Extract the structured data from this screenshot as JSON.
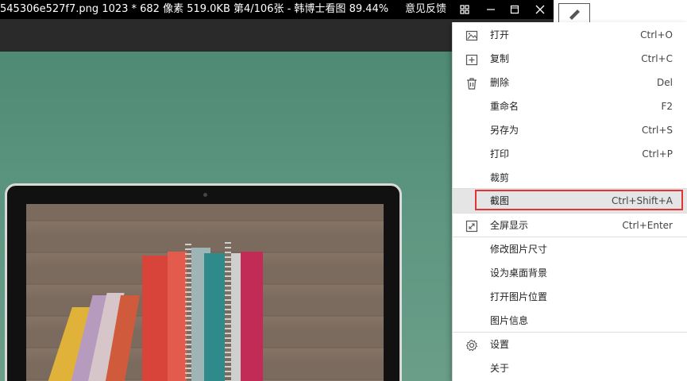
{
  "titlebar": {
    "title": "545306e527f7.png  1023 * 682 像素  519.0KB  第4/106张  - 韩博士看图 89.44%",
    "feedback": "意见反馈",
    "icons": [
      "grid-icon",
      "minimize-icon",
      "maximize-icon",
      "close-icon"
    ]
  },
  "menu": {
    "items": [
      {
        "label": "打开",
        "shortcut": "Ctrl+O",
        "icon": "image-icon"
      },
      {
        "label": "复制",
        "shortcut": "Ctrl+C",
        "icon": "copy-icon"
      },
      {
        "label": "删除",
        "shortcut": "Del",
        "icon": "trash-icon"
      },
      {
        "label": "重命名",
        "shortcut": "F2"
      },
      {
        "label": "另存为",
        "shortcut": "Ctrl+S"
      },
      {
        "label": "打印",
        "shortcut": "Ctrl+P"
      },
      {
        "label": "裁剪",
        "shortcut": ""
      },
      {
        "label": "截图",
        "shortcut": "Ctrl+Shift+A",
        "highlighted": true
      },
      {
        "label": "全屏显示",
        "shortcut": "Ctrl+Enter",
        "icon": "fullscreen-icon"
      },
      {
        "label": "修改图片尺寸",
        "shortcut": ""
      },
      {
        "label": "设为桌面背景",
        "shortcut": ""
      },
      {
        "label": "打开图片位置",
        "shortcut": ""
      },
      {
        "label": "图片信息",
        "shortcut": ""
      },
      {
        "label": "设置",
        "shortcut": "",
        "icon": "gear-icon"
      },
      {
        "label": "关于",
        "shortcut": ""
      }
    ]
  },
  "colors": {
    "highlight_border": "#e23434",
    "highlight_bg": "#e5e5e5",
    "canvas_bg": "#5f9782"
  }
}
